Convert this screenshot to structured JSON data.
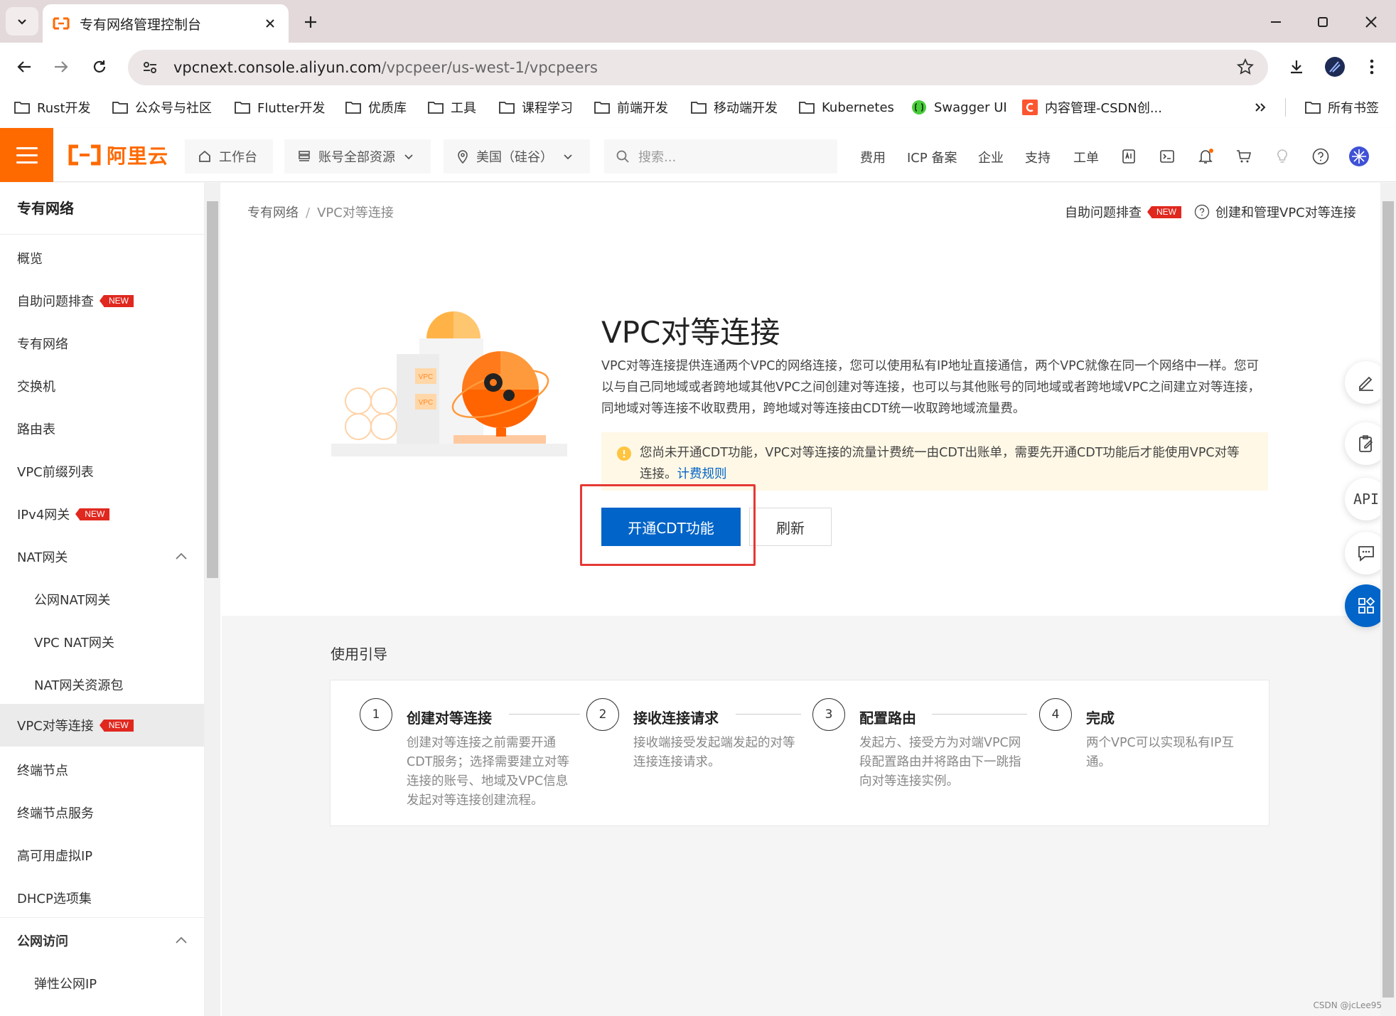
{
  "browser": {
    "tab_title": "专有网络管理控制台",
    "url_host": "vpcnext.console.aliyun.com",
    "url_path": "/vpcpeer/us-west-1/vpcpeers",
    "bookmarks": [
      "Rust开发",
      "公众号与社区",
      "Flutter开发",
      "优质库",
      "工具",
      "课程学习",
      "前端开发",
      "移动端开发",
      "Kubernetes",
      "Swagger UI",
      "内容管理-CSDN创..."
    ],
    "all_bookmarks": "所有书签"
  },
  "header": {
    "logo_text": "阿里云",
    "workbench": "工作台",
    "resources": "账号全部资源",
    "region": "美国（硅谷）",
    "search_placeholder": "搜索...",
    "links": [
      "费用",
      "ICP 备案",
      "企业",
      "支持",
      "工单"
    ]
  },
  "sidebar": {
    "title": "专有网络",
    "items": [
      {
        "label": "概览"
      },
      {
        "label": "自助问题排查",
        "badge": "NEW"
      },
      {
        "label": "专有网络"
      },
      {
        "label": "交换机"
      },
      {
        "label": "路由表"
      },
      {
        "label": "VPC前缀列表"
      },
      {
        "label": "IPv4网关",
        "badge": "NEW"
      },
      {
        "label": "NAT网关"
      },
      {
        "label": "公网NAT网关"
      },
      {
        "label": "VPC NAT网关"
      },
      {
        "label": "NAT网关资源包"
      },
      {
        "label": "VPC对等连接",
        "badge": "NEW"
      },
      {
        "label": "终端节点"
      },
      {
        "label": "终端节点服务"
      },
      {
        "label": "高可用虚拟IP"
      },
      {
        "label": "DHCP选项集"
      },
      {
        "label": "公网访问"
      },
      {
        "label": "弹性公网IP"
      }
    ]
  },
  "breadcrumb": {
    "root": "专有网络",
    "separator": "/",
    "current": "VPC对等连接"
  },
  "top_links": {
    "troubleshoot": "自助问题排查",
    "badge": "NEW",
    "help": "创建和管理VPC对等连接"
  },
  "hero": {
    "title": "VPC对等连接",
    "description": "VPC对等连接提供连通两个VPC的网络连接，您可以使用私有IP地址直接通信，两个VPC就像在同一个网络中一样。您可以与自己同地域或者跨地域其他VPC之间创建对等连接，也可以与其他账号的同地域或者跨地域VPC之间建立对等连接，同地域对等连接不收取费用，跨地域对等连接由CDT统一收取跨地域流量费。",
    "illustration_label": "VPC"
  },
  "alert": {
    "text": "您尚未开通CDT功能，VPC对等连接的流量计费统一由CDT出账单，需要先开通CDT功能后才能使用VPC对等连接。",
    "link": "计费规则"
  },
  "actions": {
    "primary": "开通CDT功能",
    "secondary": "刷新"
  },
  "guide": {
    "title": "使用引导",
    "steps": [
      {
        "num": "1",
        "title": "创建对等连接",
        "desc": "创建对等连接之前需要开通CDT服务；选择需要建立对等连接的账号、地域及VPC信息发起对等连接创建流程。"
      },
      {
        "num": "2",
        "title": "接收连接请求",
        "desc": "接收端接受发起端发起的对等连接连接请求。"
      },
      {
        "num": "3",
        "title": "配置路由",
        "desc": "发起方、接受方为对端VPC网段配置路由并将路由下一跳指向对等连接实例。"
      },
      {
        "num": "4",
        "title": "完成",
        "desc": "两个VPC可以实现私有IP互通。"
      }
    ]
  },
  "float_api": "API",
  "watermark": "CSDN @jcLee95",
  "colors": {
    "brand": "#ff6a00",
    "primary": "#0064c8",
    "badge": "#e0281f",
    "alert_bg": "#fff8e6",
    "highlight": "#e53935"
  }
}
